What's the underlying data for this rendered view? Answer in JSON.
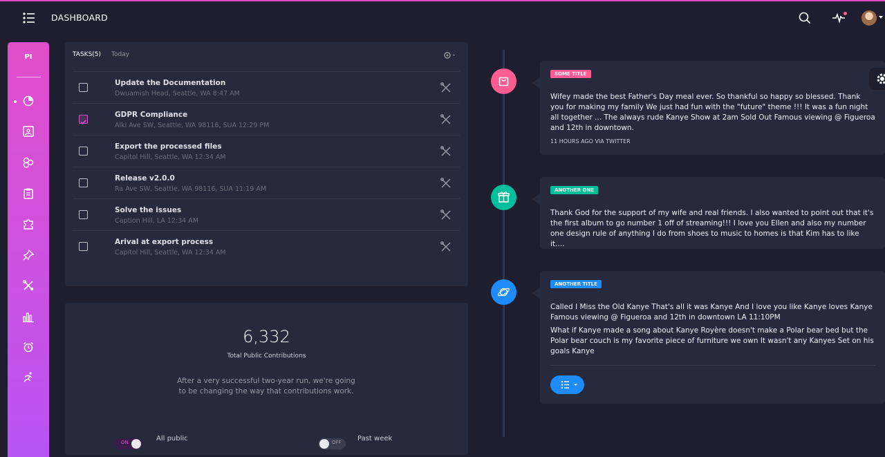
{
  "header": {
    "brand": "DASHBOARD",
    "menu_icon": "list-icon",
    "search_icon": "search-icon",
    "activity_icon": "pulse-icon",
    "avatar_icon": "avatar"
  },
  "sidebar": {
    "logo": "PI",
    "items": [
      {
        "icon": "chart-pie-icon"
      },
      {
        "icon": "image-icon"
      },
      {
        "icon": "atom-icon"
      },
      {
        "icon": "clipboard-icon"
      },
      {
        "icon": "puzzle-icon"
      },
      {
        "icon": "pin-icon"
      },
      {
        "icon": "tools-icon"
      },
      {
        "icon": "bar-chart-icon"
      },
      {
        "icon": "alarm-icon"
      },
      {
        "icon": "runner-icon"
      }
    ]
  },
  "tasks": {
    "title": "TASKS(5)",
    "subtitle": "Today",
    "items": [
      {
        "title": "Update the Documentation",
        "meta": "Dwuamish Head, Seattle, WA 8:47 AM",
        "checked": false
      },
      {
        "title": "GDPR Compliance",
        "meta": "Alki Ave SW, Seattle, WA 98116, SUA 12:29 PM",
        "checked": true
      },
      {
        "title": "Export the processed files",
        "meta": "Capitol Hill, Seattle, WA 12:34 AM",
        "checked": false
      },
      {
        "title": "Release v2.0.0",
        "meta": "Ra Ave SW, Seattle, WA 98116, SUA 11:19 AM",
        "checked": false
      },
      {
        "title": "Solve the issues",
        "meta": "Caption Hill, LA 12:34 AM",
        "checked": false
      },
      {
        "title": "Arival at export process",
        "meta": "Capitol Hill, Seattle, WA 12:34 AM",
        "checked": false
      }
    ]
  },
  "contributions": {
    "number": "6,332",
    "label": "Total Public Contributions",
    "text": "After a very successful two-year run, we're going to be changing the way that contributions work.",
    "toggle_all_label": "All public",
    "toggle_all_text": "ON",
    "toggle_week_label": "Past week",
    "toggle_week_text": "OFF"
  },
  "timeline": [
    {
      "tag": "SOME TITLE",
      "tag_color": "#fd5d93",
      "badge_color": "#fd5d93",
      "badge_icon": "shopping-bag-icon",
      "text": "Wifey made the best Father's Day meal ever. So thankful so happy so blessed. Thank you for making my family We just had fun with the \"future\" theme !!! It was a fun night all together ... The always rude Kanye Show at 2am Sold Out Famous viewing @ Figueroa and 12th in downtown.",
      "footer": "11 HOURS AGO VIA TWITTER"
    },
    {
      "tag": "ANOTHER ONE",
      "tag_color": "#00bf9a",
      "badge_color": "#00bf9a",
      "badge_icon": "gift-icon",
      "text": "Thank God for the support of my wife and real friends. I also wanted to point out that it's the first album to go number 1 off of streaming!!! I love you Ellen and also my number one design rule of anything I do from shoes to music to homes is that Kim has to like it...."
    },
    {
      "tag": "ANOTHER TITLE",
      "tag_color": "#1d8cf8",
      "badge_color": "#1d8cf8",
      "badge_icon": "planet-icon",
      "text": "Called I Miss the Old Kanye That's all it was Kanye And I love you like Kanye loves Kanye Famous viewing @ Figueroa and 12th in downtown LA 11:10PM",
      "text2": "What if Kanye made a song about Kanye Royère doesn't make a Polar bear bed but the Polar bear couch is my favorite piece of furniture we own It wasn't any Kanyes Set on his goals Kanye",
      "button_icon": "list-icon"
    }
  ]
}
